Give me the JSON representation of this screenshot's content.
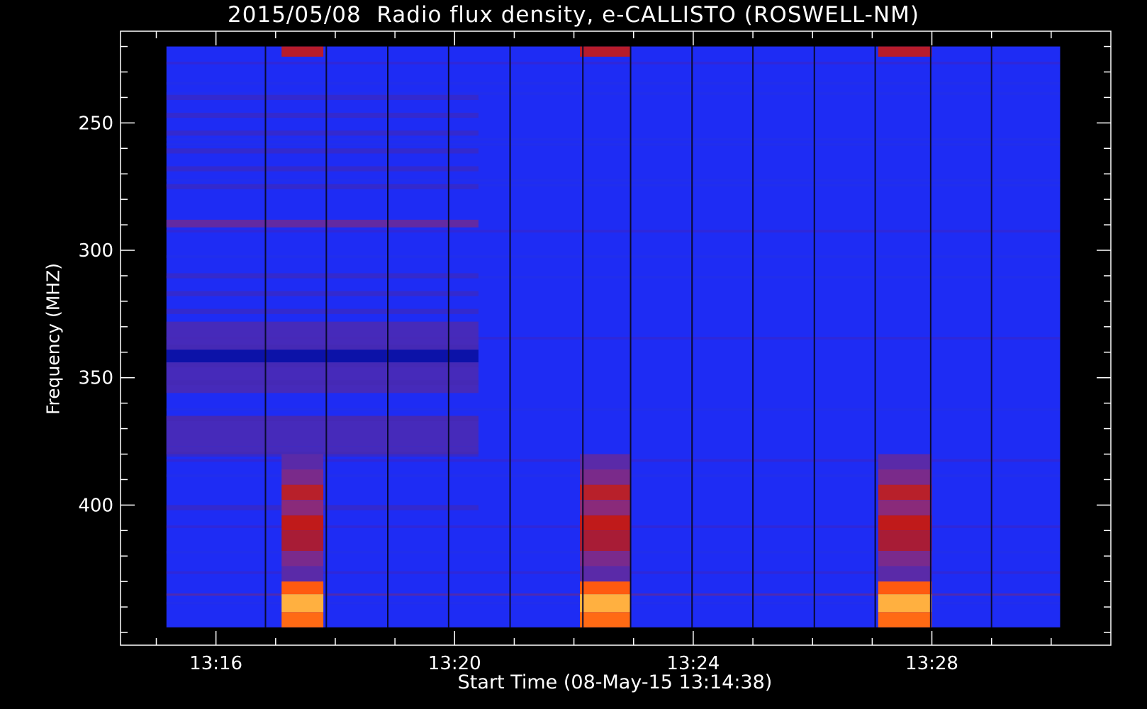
{
  "chart_data": {
    "type": "heatmap",
    "title": "2015/05/08  Radio flux density, e-CALLISTO (ROSWELL-NM)",
    "xlabel": "Start Time (08-May-15 13:14:38)",
    "ylabel": "Frequency (MHZ)",
    "x_ticks": [
      "13:16",
      "13:20",
      "13:24",
      "13:28"
    ],
    "x_tick_minutes": [
      16,
      20,
      24,
      28
    ],
    "x_range_minutes": [
      14.4,
      31.0
    ],
    "data_range_minutes": [
      15.17,
      30.15
    ],
    "y_ticks": [
      250,
      300,
      350,
      400
    ],
    "y_range_mhz": [
      214,
      455
    ],
    "data_range_mhz": [
      220,
      448
    ],
    "y_inverted": true,
    "file_boundaries_minutes": [
      16.83,
      17.85,
      18.88,
      19.9,
      20.93,
      22.15,
      22.95,
      23.98,
      25.0,
      26.03,
      27.05,
      27.98,
      29.0
    ],
    "background_color": "#1e2cf4",
    "strong_bands_left": [
      {
        "mhz": [
          288,
          291
        ],
        "intensity": 0.55
      },
      {
        "mhz": [
          328,
          339
        ],
        "intensity": 0.5
      },
      {
        "mhz": [
          339,
          344
        ],
        "intensity": -0.4
      },
      {
        "mhz": [
          344,
          356
        ],
        "intensity": 0.35
      },
      {
        "mhz": [
          365,
          377
        ],
        "intensity": 0.45
      },
      {
        "mhz": [
          377,
          380
        ],
        "intensity": 0.3
      }
    ],
    "left_bands_end_minute": 20.4,
    "calibration_bursts": [
      {
        "minutes": [
          17.1,
          17.8
        ]
      },
      {
        "minutes": [
          22.1,
          22.95
        ]
      },
      {
        "minutes": [
          27.1,
          28.0
        ]
      }
    ],
    "interference_line_mhz": 435
  }
}
